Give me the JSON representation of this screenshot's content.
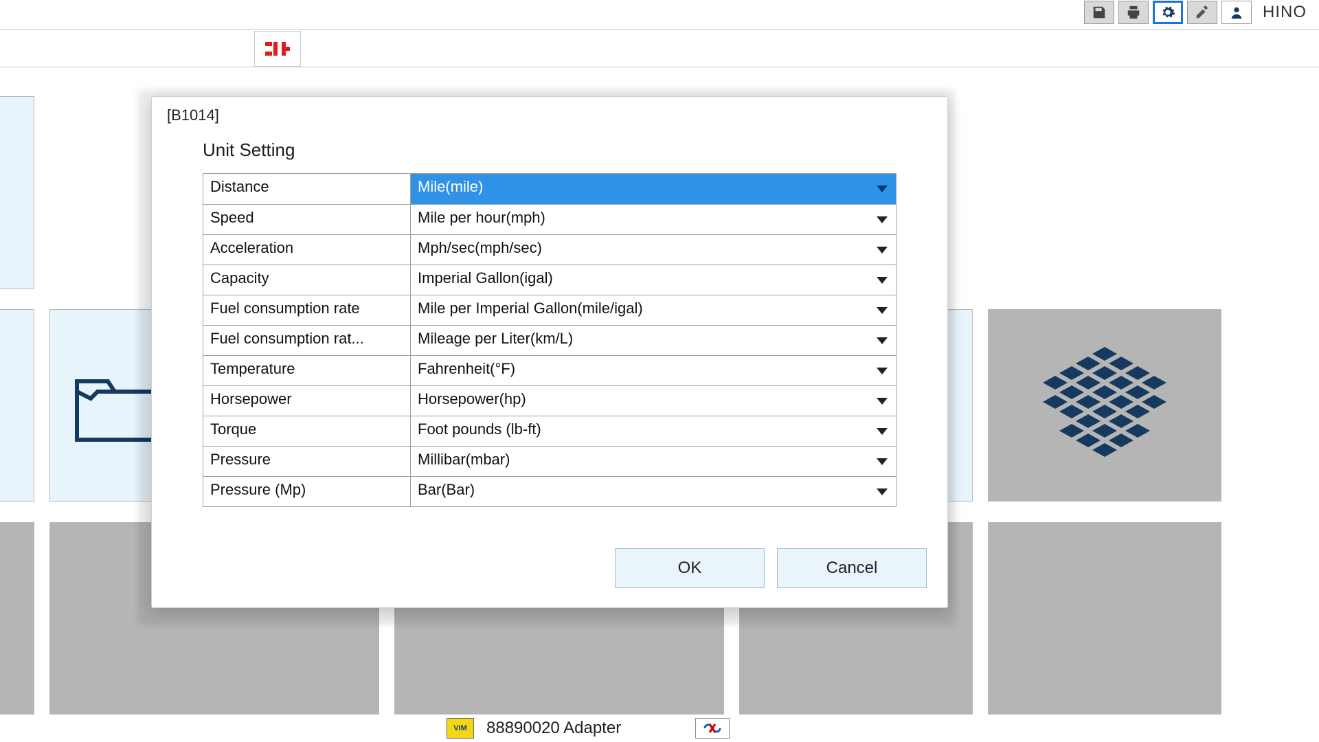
{
  "brand": "HINO",
  "dialog": {
    "code": "[B1014]",
    "title": "Unit Setting",
    "rows": [
      {
        "label": "Distance",
        "value": "Mile(mile)",
        "selected": true
      },
      {
        "label": "Speed",
        "value": "Mile per hour(mph)"
      },
      {
        "label": "Acceleration",
        "value": "Mph/sec(mph/sec)"
      },
      {
        "label": "Capacity",
        "value": "Imperial Gallon(igal)"
      },
      {
        "label": "Fuel consumption rate",
        "value": "Mile per Imperial Gallon(mile/igal)"
      },
      {
        "label": "Fuel consumption rat...",
        "value": "Mileage per Liter(km/L)"
      },
      {
        "label": "Temperature",
        "value": "Fahrenheit(°F)"
      },
      {
        "label": "Horsepower",
        "value": "Horsepower(hp)"
      },
      {
        "label": "Torque",
        "value": "Foot pounds (lb-ft)"
      },
      {
        "label": "Pressure",
        "value": "Millibar(mbar)"
      },
      {
        "label": "Pressure (Mp)",
        "value": "Bar(Bar)"
      }
    ],
    "ok": "OK",
    "cancel": "Cancel"
  },
  "status": {
    "adapter": "88890020 Adapter"
  }
}
